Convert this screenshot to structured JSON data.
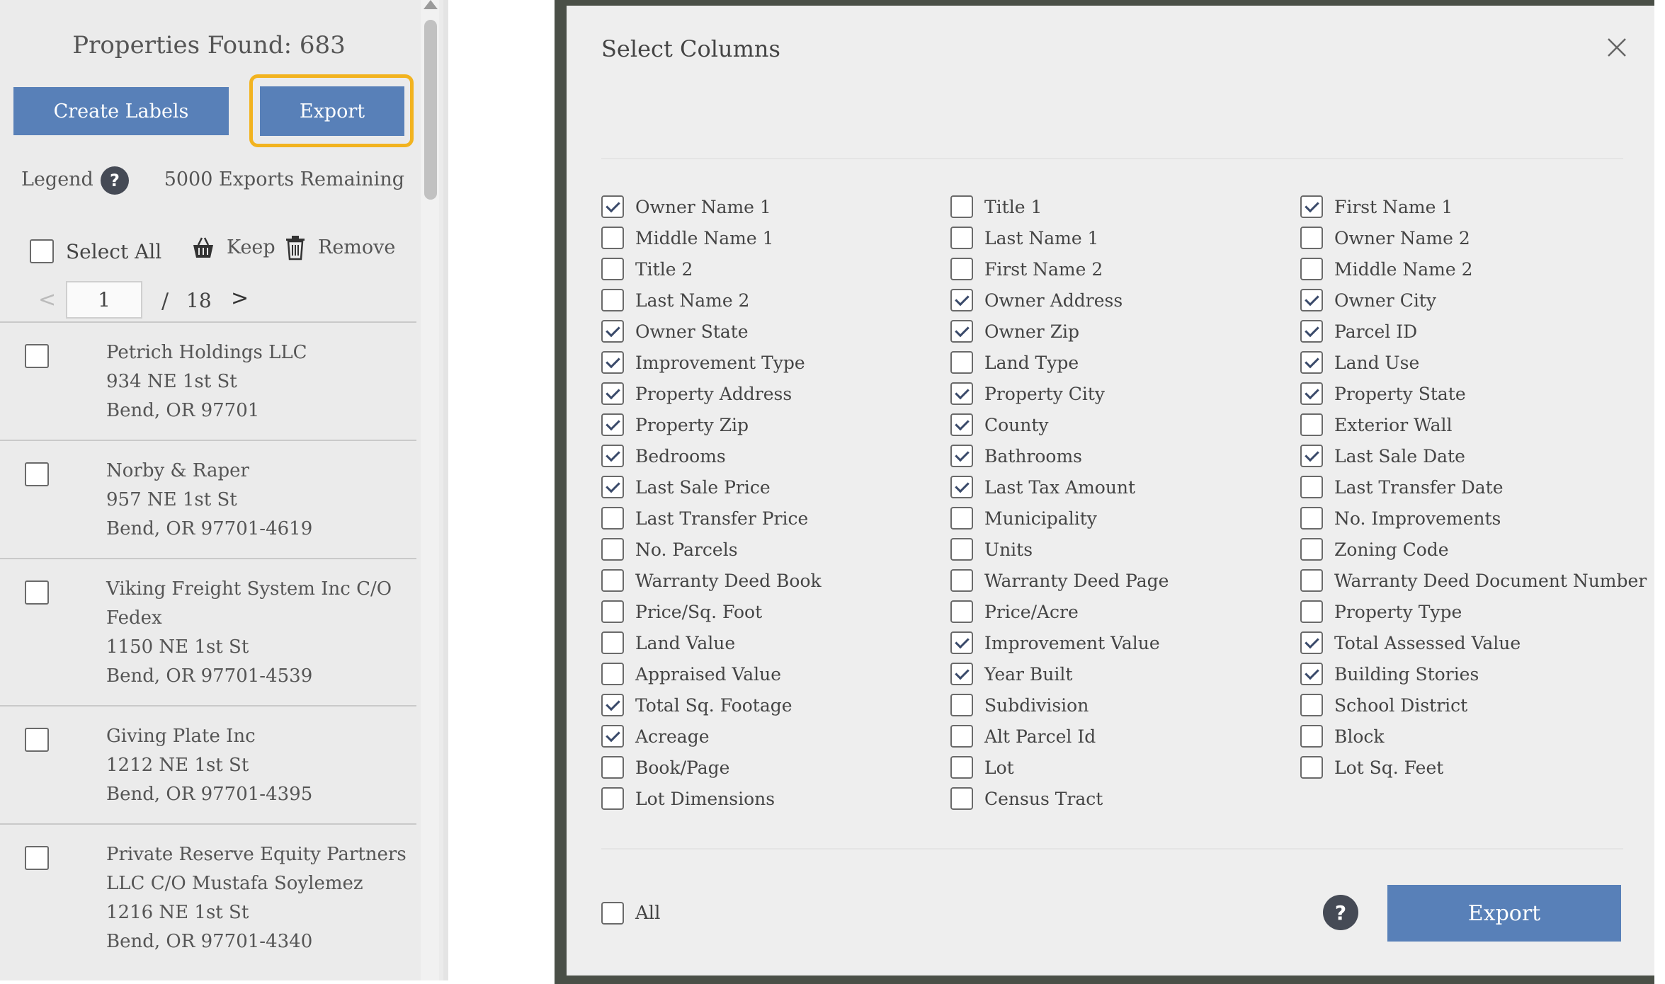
{
  "left": {
    "found_title": "Properties Found: 683",
    "create_labels": "Create Labels",
    "export": "Export",
    "legend": "Legend",
    "help": "?",
    "exports_remaining": "5000 Exports Remaining",
    "select_all": "Select All",
    "keep": "Keep",
    "remove": "Remove",
    "pagination": {
      "prev": "<",
      "page": "1",
      "sep": "/",
      "total": "18",
      "next": ">"
    },
    "results": [
      {
        "lines": [
          "Petrich Holdings LLC",
          "934 NE 1st St",
          "Bend, OR 97701"
        ]
      },
      {
        "lines": [
          "Norby & Raper",
          "957 NE 1st St",
          "Bend, OR 97701-4619"
        ]
      },
      {
        "lines": [
          "Viking Freight System Inc C/O",
          "Fedex",
          "1150 NE 1st St",
          "Bend, OR 97701-4539"
        ]
      },
      {
        "lines": [
          "Giving Plate Inc",
          "1212 NE 1st St",
          "Bend, OR 97701-4395"
        ]
      },
      {
        "lines": [
          "Private Reserve Equity Partners",
          "LLC C/O Mustafa Soylemez",
          "1216 NE 1st St",
          "Bend, OR 97701-4340"
        ]
      }
    ]
  },
  "modal": {
    "title": "Select Columns",
    "all_label": "All",
    "help": "?",
    "export": "Export",
    "columns": [
      [
        {
          "label": "Owner Name 1",
          "checked": true
        },
        {
          "label": "Middle Name 1",
          "checked": false
        },
        {
          "label": "Title 2",
          "checked": false
        },
        {
          "label": "Last Name 2",
          "checked": false
        },
        {
          "label": "Owner State",
          "checked": true
        },
        {
          "label": "Improvement Type",
          "checked": true
        },
        {
          "label": "Property Address",
          "checked": true
        },
        {
          "label": "Property Zip",
          "checked": true
        },
        {
          "label": "Bedrooms",
          "checked": true
        },
        {
          "label": "Last Sale Price",
          "checked": true
        },
        {
          "label": "Last Transfer Price",
          "checked": false
        },
        {
          "label": "No. Parcels",
          "checked": false
        },
        {
          "label": "Warranty Deed Book",
          "checked": false
        },
        {
          "label": "Price/Sq. Foot",
          "checked": false
        },
        {
          "label": "Land Value",
          "checked": false
        },
        {
          "label": "Appraised Value",
          "checked": false
        },
        {
          "label": "Total Sq. Footage",
          "checked": true
        },
        {
          "label": "Acreage",
          "checked": true
        },
        {
          "label": "Book/Page",
          "checked": false
        },
        {
          "label": "Lot Dimensions",
          "checked": false
        }
      ],
      [
        {
          "label": "Title 1",
          "checked": false
        },
        {
          "label": "Last Name 1",
          "checked": false
        },
        {
          "label": "First Name 2",
          "checked": false
        },
        {
          "label": "Owner Address",
          "checked": true
        },
        {
          "label": "Owner Zip",
          "checked": true
        },
        {
          "label": "Land Type",
          "checked": false
        },
        {
          "label": "Property City",
          "checked": true
        },
        {
          "label": "County",
          "checked": true
        },
        {
          "label": "Bathrooms",
          "checked": true
        },
        {
          "label": "Last Tax Amount",
          "checked": true
        },
        {
          "label": "Municipality",
          "checked": false
        },
        {
          "label": "Units",
          "checked": false
        },
        {
          "label": "Warranty Deed Page",
          "checked": false
        },
        {
          "label": "Price/Acre",
          "checked": false
        },
        {
          "label": "Improvement Value",
          "checked": true
        },
        {
          "label": "Year Built",
          "checked": true
        },
        {
          "label": "Subdivision",
          "checked": false
        },
        {
          "label": "Alt Parcel Id",
          "checked": false
        },
        {
          "label": "Lot",
          "checked": false
        },
        {
          "label": "Census Tract",
          "checked": false
        }
      ],
      [
        {
          "label": "First Name 1",
          "checked": true
        },
        {
          "label": "Owner Name 2",
          "checked": false
        },
        {
          "label": "Middle Name 2",
          "checked": false
        },
        {
          "label": "Owner City",
          "checked": true
        },
        {
          "label": "Parcel ID",
          "checked": true
        },
        {
          "label": "Land Use",
          "checked": true
        },
        {
          "label": "Property State",
          "checked": true
        },
        {
          "label": "Exterior Wall",
          "checked": false
        },
        {
          "label": "Last Sale Date",
          "checked": true
        },
        {
          "label": "Last Transfer Date",
          "checked": false
        },
        {
          "label": "No. Improvements",
          "checked": false
        },
        {
          "label": "Zoning Code",
          "checked": false
        },
        {
          "label": "Warranty Deed Document Number",
          "checked": false
        },
        {
          "label": "Property Type",
          "checked": false
        },
        {
          "label": "Total Assessed Value",
          "checked": true
        },
        {
          "label": "Building Stories",
          "checked": true
        },
        {
          "label": "School District",
          "checked": false
        },
        {
          "label": "Block",
          "checked": false
        },
        {
          "label": "Lot Sq. Feet",
          "checked": false
        }
      ]
    ]
  }
}
